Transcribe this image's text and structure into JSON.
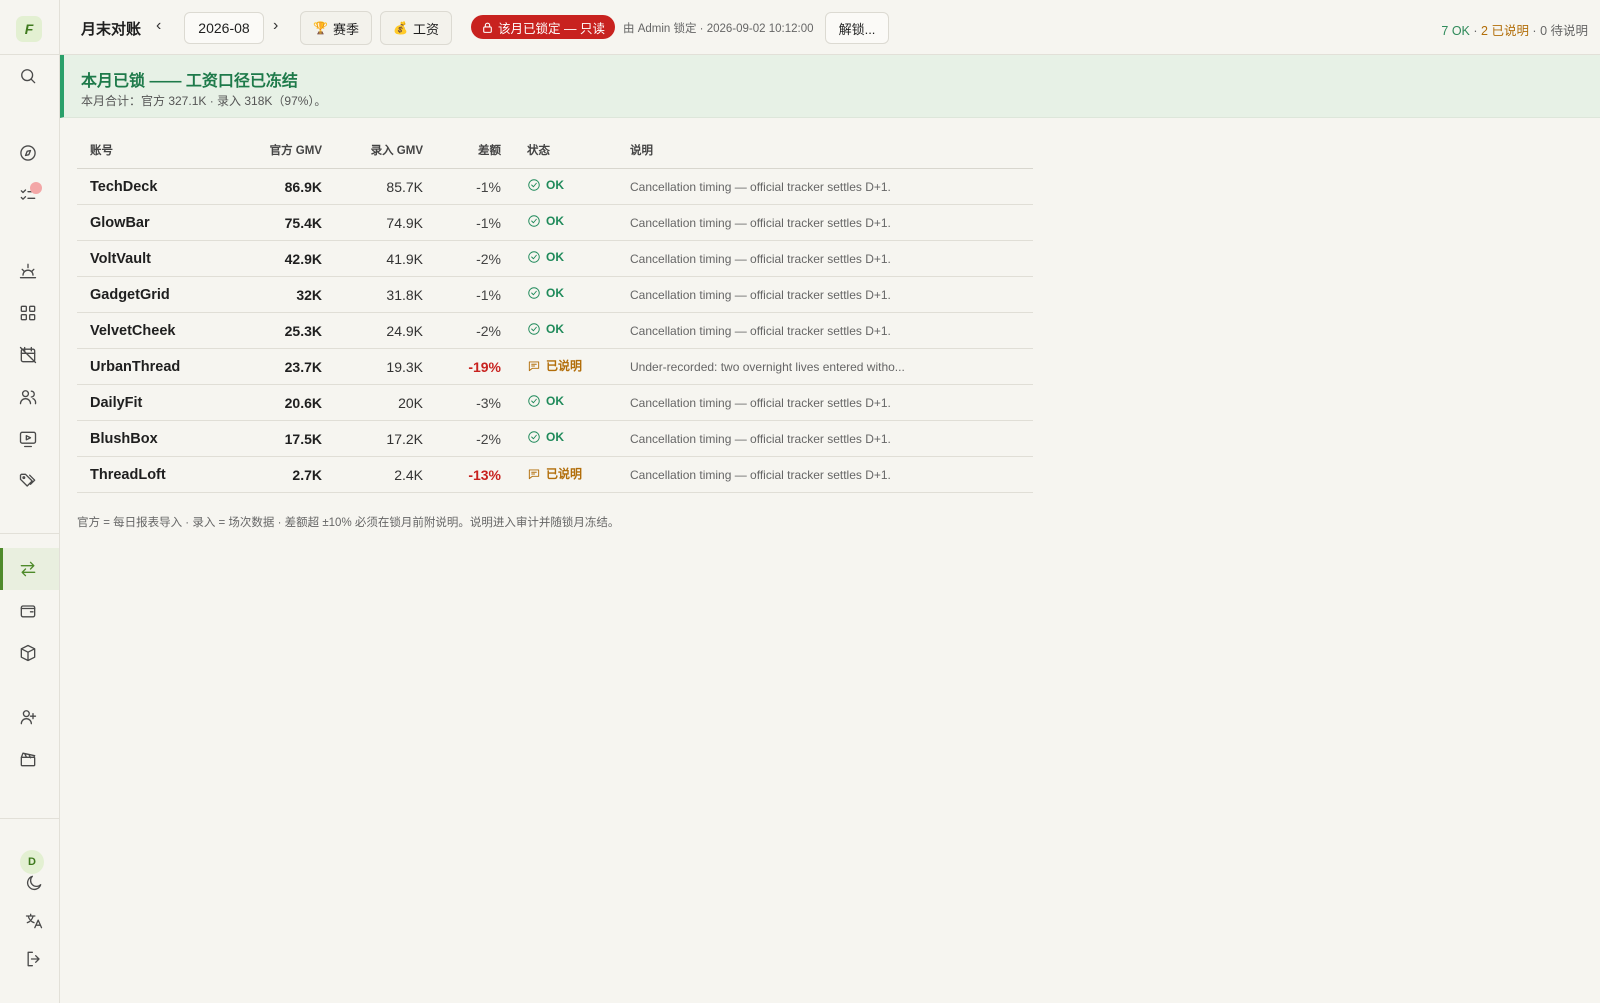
{
  "header": {
    "title": "月末对账",
    "prev_icon": "chevron-left-icon",
    "next_icon": "chevron-right-icon",
    "month": "2026-08",
    "season_label": "赛季",
    "salary_label": "工资",
    "locked_label": "该月已锁定 — 只读",
    "lock_info": "由 Admin 锁定 · 2026-09-02 10:12:00",
    "unlock_label": "解锁...",
    "summary_ok": "7 OK",
    "summary_sep1": " · ",
    "summary_explained": "2 已说明",
    "summary_sep2": " · ",
    "summary_pending": "0 待说明"
  },
  "banner": {
    "title": "本月已锁 —— 工资口径已冻结",
    "subtitle": "本月合计：官方 327.1K · 录入 318K（97%）。"
  },
  "sidebar": {
    "logo": "F",
    "avatar": "D",
    "icons": [
      "search-icon",
      "compass-icon",
      "task-list-icon",
      "sunrise-icon",
      "grid-icon",
      "calendar-off-icon",
      "users-icon",
      "monitor-play-icon",
      "tags-icon",
      "arrows-exchange-icon",
      "wallet-icon",
      "box-icon",
      "user-plus-icon",
      "clapperboard-icon",
      "moon-icon",
      "translate-icon",
      "logout-icon"
    ]
  },
  "table": {
    "headers": {
      "account": "账号",
      "official": "官方 GMV",
      "recorded": "录入 GMV",
      "diff": "差额",
      "status": "状态",
      "note": "说明"
    },
    "rows": [
      {
        "account": "TechDeck",
        "official": "86.9K",
        "recorded": "85.7K",
        "diff": "-1%",
        "status": "OK",
        "status_type": "ok",
        "note": "Cancellation timing — official tracker settles D+1."
      },
      {
        "account": "GlowBar",
        "official": "75.4K",
        "recorded": "74.9K",
        "diff": "-1%",
        "status": "OK",
        "status_type": "ok",
        "note": "Cancellation timing — official tracker settles D+1."
      },
      {
        "account": "VoltVault",
        "official": "42.9K",
        "recorded": "41.9K",
        "diff": "-2%",
        "status": "OK",
        "status_type": "ok",
        "note": "Cancellation timing — official tracker settles D+1."
      },
      {
        "account": "GadgetGrid",
        "official": "32K",
        "recorded": "31.8K",
        "diff": "-1%",
        "status": "OK",
        "status_type": "ok",
        "note": "Cancellation timing — official tracker settles D+1."
      },
      {
        "account": "VelvetCheek",
        "official": "25.3K",
        "recorded": "24.9K",
        "diff": "-2%",
        "status": "OK",
        "status_type": "ok",
        "note": "Cancellation timing — official tracker settles D+1."
      },
      {
        "account": "UrbanThread",
        "official": "23.7K",
        "recorded": "19.3K",
        "diff": "-19%",
        "status": "已说明",
        "status_type": "explained",
        "note": "Under-recorded: two overnight lives entered witho..."
      },
      {
        "account": "DailyFit",
        "official": "20.6K",
        "recorded": "20K",
        "diff": "-3%",
        "status": "OK",
        "status_type": "ok",
        "note": "Cancellation timing — official tracker settles D+1."
      },
      {
        "account": "BlushBox",
        "official": "17.5K",
        "recorded": "17.2K",
        "diff": "-2%",
        "status": "OK",
        "status_type": "ok",
        "note": "Cancellation timing — official tracker settles D+1."
      },
      {
        "account": "ThreadLoft",
        "official": "2.7K",
        "recorded": "2.4K",
        "diff": "-13%",
        "status": "已说明",
        "status_type": "explained",
        "note": "Cancellation timing — official tracker settles D+1."
      }
    ]
  },
  "footnote": "官方 = 每日报表导入 · 录入 = 场次数据 · 差额超 ±10% 必须在锁月前附说明。说明进入审计并随锁月冻结。",
  "colors": {
    "accent": "#4e8a2a",
    "ok": "#1f8a5a",
    "explained": "#b26e0a",
    "danger": "#c8221f",
    "banner_bg": "#e7f1e6"
  }
}
